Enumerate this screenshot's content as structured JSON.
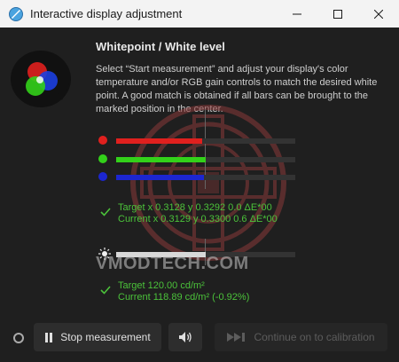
{
  "window": {
    "title": "Interactive display adjustment"
  },
  "header": {
    "heading": "Whitepoint / White level",
    "description": "Select “Start measurement” and adjust your display's color temperature and/or RGB gain controls to match the desired white point. A good match is obtained if all bars can be brought to the marked position in the center."
  },
  "bars": [
    {
      "name": "red",
      "color": "#e0201e",
      "fill": 0.48
    },
    {
      "name": "green",
      "color": "#33d11a",
      "fill": 0.5
    },
    {
      "name": "blue",
      "color": "#1c26d0",
      "fill": 0.49
    }
  ],
  "whitepoint": {
    "target": "Target x 0.3128 y 0.3292 0.0 ΔE*00",
    "current": "Current x 0.3129 y 0.3300 0.6 ΔE*00"
  },
  "luminance": {
    "fill": 0.5,
    "target": "Target 120.00 cd/m²",
    "current": "Current 118.89 cd/m² (-0.92%)"
  },
  "watermark_text": "VMODTECH.COM",
  "buttons": {
    "stop": "Stop measurement",
    "continue": "Continue on to calibration"
  },
  "colors": {
    "accent_green": "#4bc23a"
  }
}
